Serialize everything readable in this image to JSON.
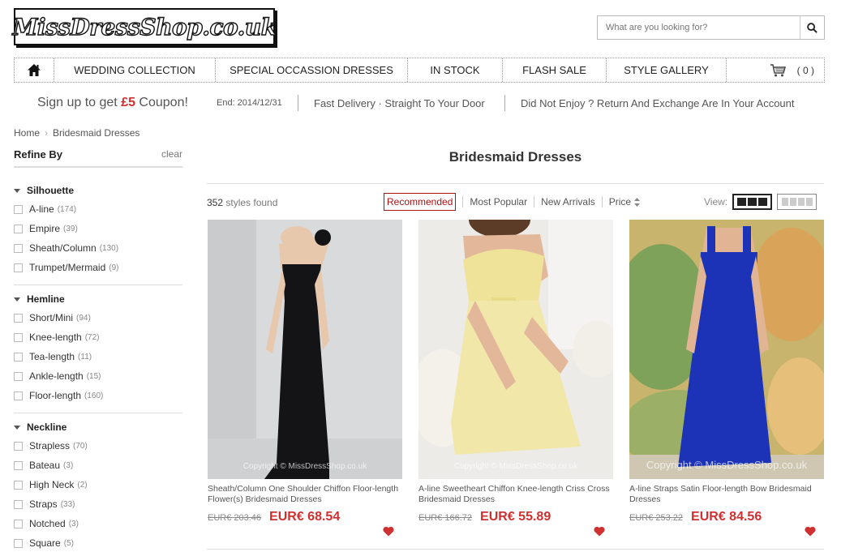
{
  "header": {
    "logo_text": "MissDressShop.co.uk",
    "search_placeholder": "What are you looking for?"
  },
  "nav": {
    "items": [
      "WEDDING COLLECTION",
      "SPECIAL OCCASSION DRESSES",
      "IN STOCK",
      "FLASH SALE",
      "STYLE GALLERY"
    ],
    "cart_count": "( 0 )"
  },
  "promo": {
    "coupon_prefix": "Sign up to get ",
    "coupon_amount": "£5",
    "coupon_suffix": " Coupon!",
    "end_text": "End: 2014/12/31",
    "delivery": "Fast Delivery · Straight To Your Door",
    "returns": "Did Not Enjoy ?  Return And Exchange Are In Your Account"
  },
  "breadcrumb": {
    "home": "Home",
    "sep": "›",
    "current": "Bridesmaid Dresses"
  },
  "refine": {
    "title": "Refine By",
    "clear": "clear",
    "groups": [
      {
        "title": "Silhouette",
        "options": [
          {
            "label": "A-line",
            "count": "(174)"
          },
          {
            "label": "Empire",
            "count": "(39)"
          },
          {
            "label": "Sheath/Column",
            "count": "(130)"
          },
          {
            "label": "Trumpet/Mermaid",
            "count": "(9)"
          }
        ]
      },
      {
        "title": "Hemline",
        "options": [
          {
            "label": "Short/Mini",
            "count": "(94)"
          },
          {
            "label": "Knee-length",
            "count": "(72)"
          },
          {
            "label": "Tea-length",
            "count": "(11)"
          },
          {
            "label": "Ankle-length",
            "count": "(15)"
          },
          {
            "label": "Floor-length",
            "count": "(160)"
          }
        ]
      },
      {
        "title": "Neckline",
        "options": [
          {
            "label": "Strapless",
            "count": "(70)"
          },
          {
            "label": "Bateau",
            "count": "(3)"
          },
          {
            "label": "High Neck",
            "count": "(2)"
          },
          {
            "label": "Straps",
            "count": "(33)"
          },
          {
            "label": "Notched",
            "count": "(3)"
          },
          {
            "label": "Square",
            "count": "(5)"
          }
        ]
      }
    ]
  },
  "main": {
    "title": "Bridesmaid Dresses",
    "count_num": "352",
    "count_label": " styles found",
    "sort": [
      "Recommended",
      "Most Popular",
      "New Arrivals",
      "Price"
    ],
    "view_label": "View:",
    "watermark": "Copyright © MissDressShop.co.uk"
  },
  "products": [
    {
      "name": "Sheath/Column One Shoulder Chiffon Floor-length Flower(s) Bridesmaid Dresses",
      "old_price": "EUR€ 203.46",
      "price": "EUR€ 68.54",
      "colors": {
        "bg": "#d9dadb",
        "dress": "#141416"
      }
    },
    {
      "name": "A-line Sweetheart Chiffon Knee-length Criss Cross Bridesmaid Dresses",
      "old_price": "EUR€ 166.72",
      "price": "EUR€ 55.89",
      "colors": {
        "bg": "#e8e6e2",
        "dress": "#efe39a"
      }
    },
    {
      "name": "A-line Straps Satin Floor-length Bow Bridesmaid Dresses",
      "old_price": "EUR€ 253.22",
      "price": "EUR€ 84.56",
      "colors": {
        "bg": "#c9b46a",
        "dress": "#1c33b8"
      }
    }
  ],
  "colors": {
    "accent": "#d0302f",
    "recommended": "#a11111"
  }
}
